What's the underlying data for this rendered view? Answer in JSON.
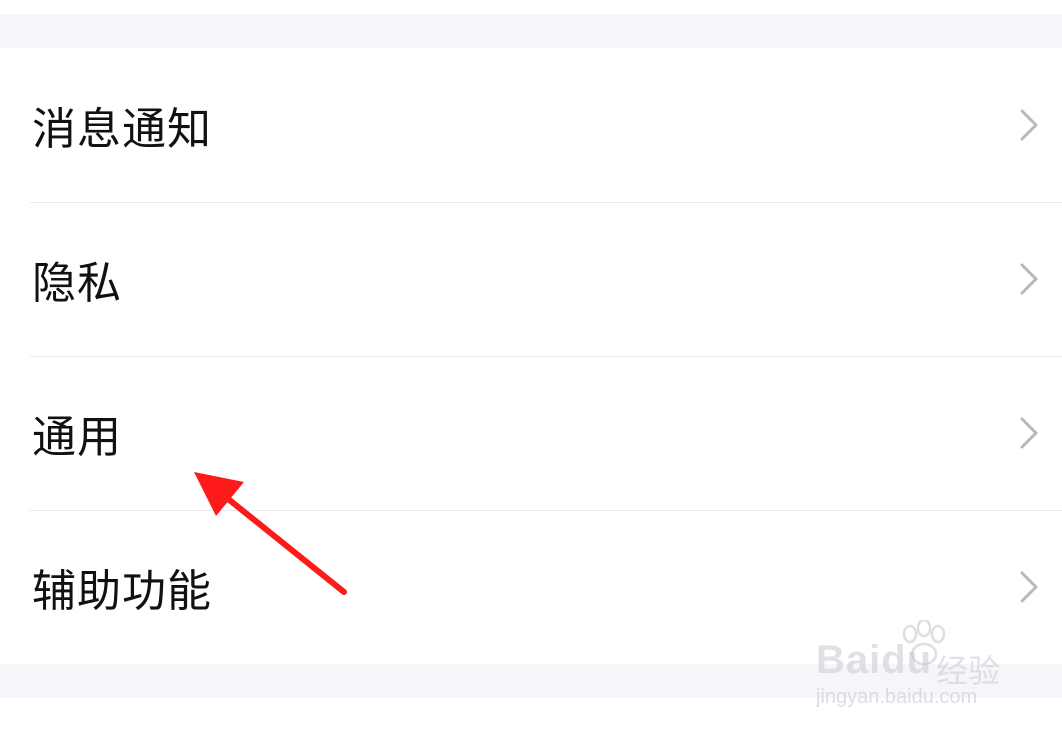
{
  "settings_list": {
    "items": [
      {
        "label": "消息通知",
        "icon": "chevron-right-icon"
      },
      {
        "label": "隐私",
        "icon": "chevron-right-icon"
      },
      {
        "label": "通用",
        "icon": "chevron-right-icon"
      },
      {
        "label": "辅助功能",
        "icon": "chevron-right-icon"
      }
    ]
  },
  "annotation": {
    "type": "arrow",
    "color": "#ff1a1a",
    "points_to": "通用"
  },
  "watermark": {
    "brand": "Baidu",
    "cn": "经验",
    "url": "jingyan.baidu.com"
  },
  "colors": {
    "background": "#ffffff",
    "section_gap": "#f5f6fa",
    "divider": "#e9e9ee",
    "text": "#111111",
    "chevron": "#b8b8be"
  }
}
